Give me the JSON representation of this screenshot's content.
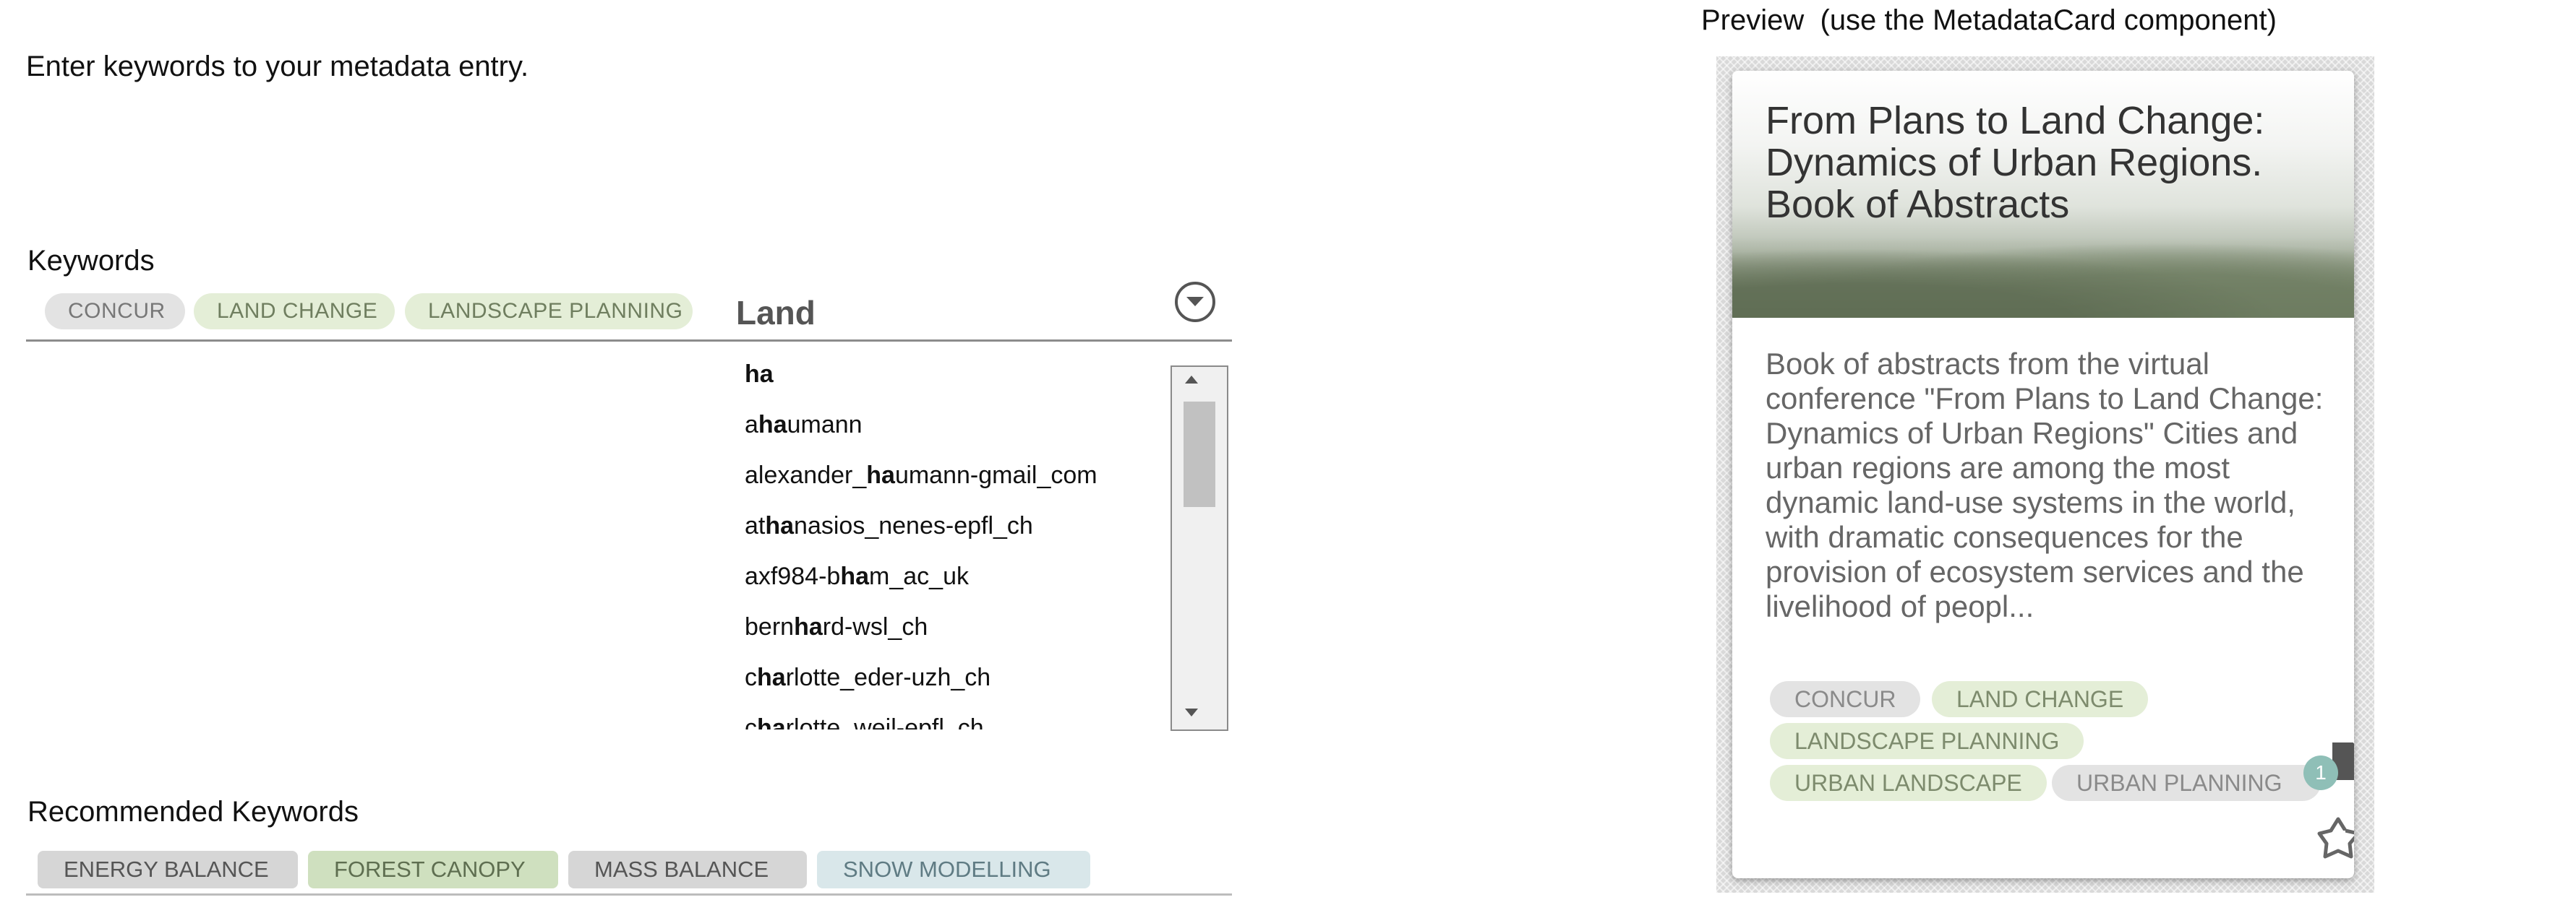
{
  "intro_text": "Enter keywords to your metadata entry.",
  "keywords": {
    "label": "Keywords",
    "selected": [
      "CONCUR",
      "LAND CHANGE",
      "LANDSCAPE PLANNING"
    ],
    "input_value": "Land",
    "suggestions": [
      {
        "pre": "",
        "hl": "ha",
        "post": ""
      },
      {
        "pre": "a",
        "hl": "ha",
        "post": "umann"
      },
      {
        "pre": "alexander_",
        "hl": "ha",
        "post": "umann-gmail_com"
      },
      {
        "pre": "at",
        "hl": "ha",
        "post": "nasios_nenes-epfl_ch"
      },
      {
        "pre": "axf984-b",
        "hl": "ha",
        "post": "m_ac_uk"
      },
      {
        "pre": "bern",
        "hl": "ha",
        "post": "rd-wsl_ch"
      },
      {
        "pre": "c",
        "hl": "ha",
        "post": "rlotte_eder-uzh_ch"
      },
      {
        "pre": "c",
        "hl": "ha",
        "post": "rlotte_weil-epfl_ch"
      }
    ]
  },
  "recommended": {
    "label": "Recommended Keywords",
    "items": [
      {
        "text": "ENERGY BALANCE",
        "color": "#d6d6d6"
      },
      {
        "text": "FOREST CANOPY",
        "color": "#cfe0bf"
      },
      {
        "text": "MASS BALANCE",
        "color": "#d6d6d6"
      },
      {
        "text": "SNOW MODELLING",
        "color": "#d9e7ea"
      }
    ]
  },
  "preview": {
    "title": "Preview  (use the MetadataCard component)",
    "card": {
      "title": "From Plans to Land Change: Dynamics of Urban Regions. Book of Abstracts",
      "description": "Book of abstracts from the virtual conference \"From Plans to Land Change: Dynamics of Urban Regions\" Cities and urban regions are among the most dynamic land-use systems in the world, with dramatic consequences for the provision of ecosystem services and the livelihood of peopl...",
      "keywords": [
        "CONCUR",
        "LAND CHANGE",
        "LANDSCAPE PLANNING",
        "URBAN LANDSCAPE",
        "URBAN PLANNING"
      ],
      "resource_count": "1",
      "file_icon": "file-icon",
      "share_icon": "share-icon"
    }
  },
  "colors": {
    "chip_grey": "#e3e3e3",
    "chip_green": "#e4eed7",
    "badge": "#8fbfb7"
  }
}
